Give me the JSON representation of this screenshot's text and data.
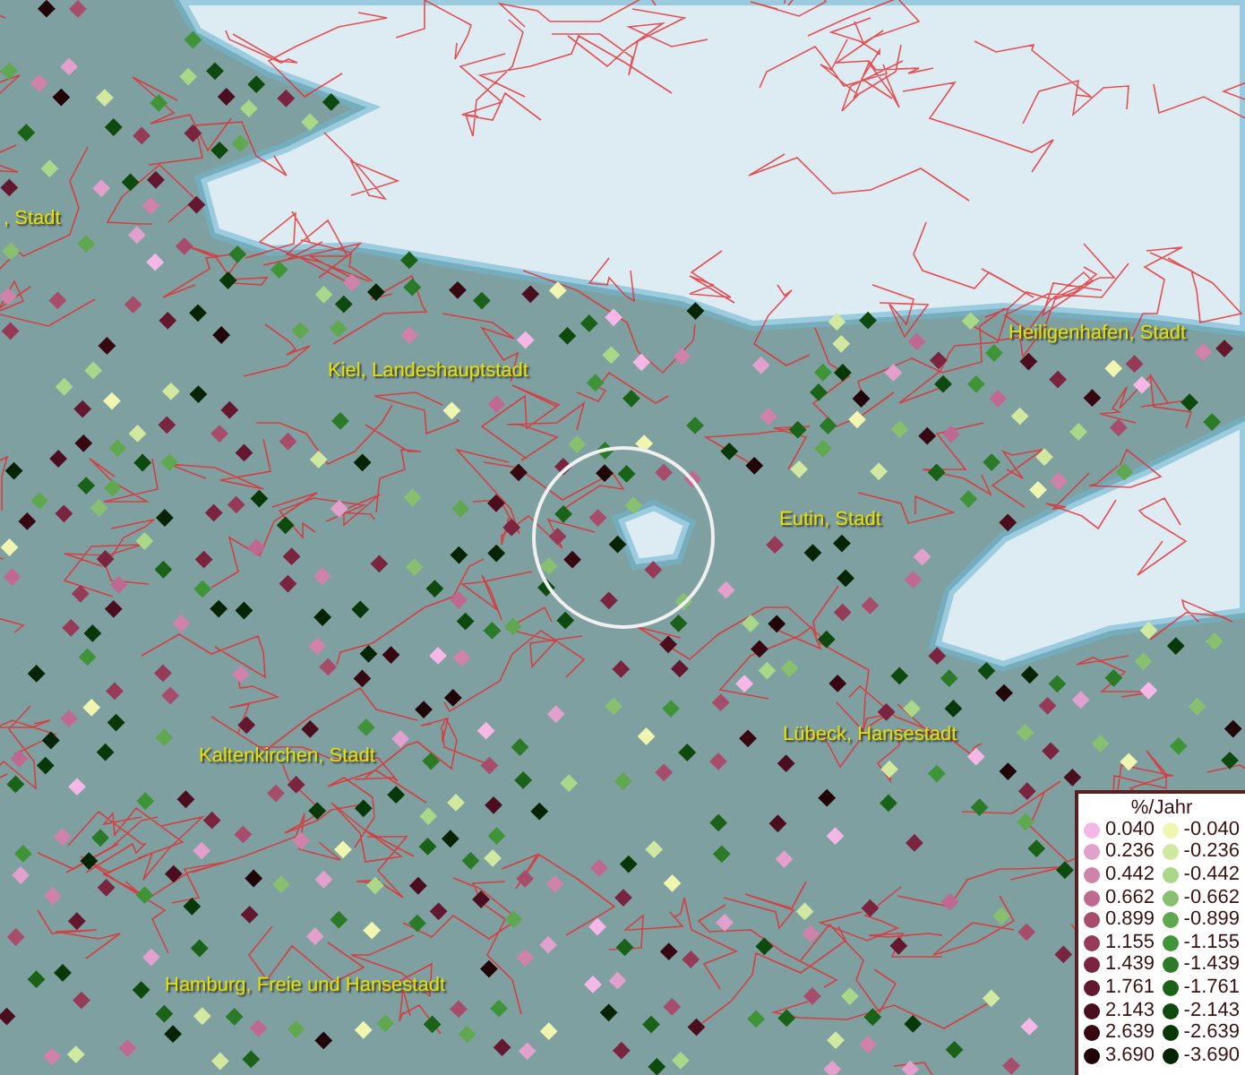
{
  "map": {
    "place_labels": [
      {
        "text": ", Stadt"
      },
      {
        "text": "Kiel, Landeshauptstadt"
      },
      {
        "text": "Heiligenhafen, Stadt"
      },
      {
        "text": "Eutin, Stadt"
      },
      {
        "text": "Lübeck, Hansestadt"
      },
      {
        "text": "Kaltenkirchen, Stadt"
      },
      {
        "text": "Hamburg, Freie und Hansestadt"
      }
    ]
  },
  "legend": {
    "title": "%/Jahr",
    "columns": [
      [
        {
          "label": "0.040",
          "color": "#f5b8e6"
        },
        {
          "label": "0.236",
          "color": "#e2a0cc"
        },
        {
          "label": "0.442",
          "color": "#d082aa"
        },
        {
          "label": "0.662",
          "color": "#bf6890"
        },
        {
          "label": "0.899",
          "color": "#a84c6c"
        },
        {
          "label": "1.155",
          "color": "#963a58"
        },
        {
          "label": "1.439",
          "color": "#7a2440"
        },
        {
          "label": "1.761",
          "color": "#641830"
        },
        {
          "label": "2.143",
          "color": "#4a0e1e"
        },
        {
          "label": "2.639",
          "color": "#380812"
        },
        {
          "label": "3.690",
          "color": "#200408"
        }
      ],
      [
        {
          "label": "-0.040",
          "color": "#f0f5b0"
        },
        {
          "label": "-0.236",
          "color": "#d0e8a0"
        },
        {
          "label": "-0.442",
          "color": "#a8d888"
        },
        {
          "label": "-0.662",
          "color": "#88c070"
        },
        {
          "label": "-0.899",
          "color": "#60a850"
        },
        {
          "label": "-1.155",
          "color": "#3f9438"
        },
        {
          "label": "-1.439",
          "color": "#2a7a28"
        },
        {
          "label": "-1.761",
          "color": "#1a6218"
        },
        {
          "label": "-2.143",
          "color": "#0e4a0e"
        },
        {
          "label": "-2.639",
          "color": "#083808"
        },
        {
          "label": "-3.690",
          "color": "#042404"
        }
      ]
    ]
  }
}
